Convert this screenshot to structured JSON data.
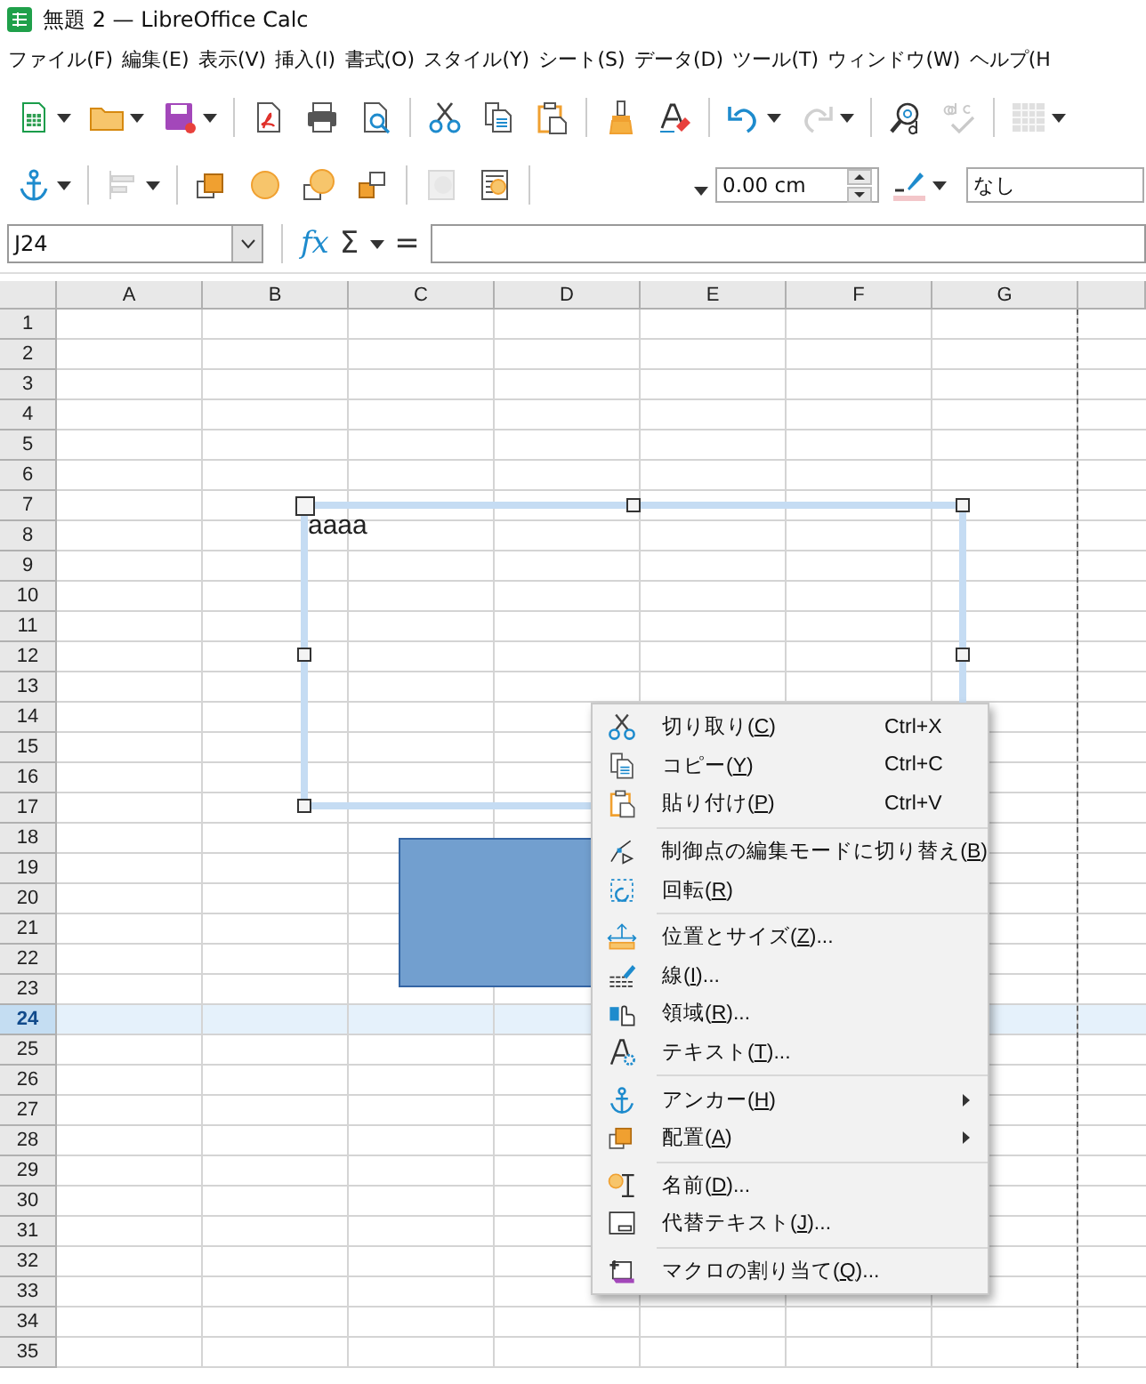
{
  "window": {
    "title": "無題 2 — LibreOffice Calc"
  },
  "menu_bar": [
    "ファイル(F)",
    "編集(E)",
    "表示(V)",
    "挿入(I)",
    "書式(O)",
    "スタイル(Y)",
    "シート(S)",
    "データ(D)",
    "ツール(T)",
    "ウィンドウ(W)",
    "ヘルプ(H"
  ],
  "toolbar_standard": [
    {
      "kind": "button",
      "dropdown": true,
      "disabled": false
    },
    {
      "kind": "button",
      "dropdown": true,
      "disabled": false
    },
    {
      "kind": "button",
      "dropdown": true,
      "disabled": false
    },
    {
      "kind": "separator"
    },
    {
      "kind": "button",
      "dropdown": false,
      "disabled": false
    },
    {
      "kind": "button",
      "dropdown": false,
      "disabled": false
    },
    {
      "kind": "button",
      "dropdown": false,
      "disabled": false
    },
    {
      "kind": "separator"
    },
    {
      "kind": "button",
      "dropdown": false,
      "disabled": false
    },
    {
      "kind": "button",
      "dropdown": false,
      "disabled": false
    },
    {
      "kind": "button",
      "dropdown": false,
      "disabled": false
    },
    {
      "kind": "separator"
    },
    {
      "kind": "button",
      "dropdown": false,
      "disabled": false
    },
    {
      "kind": "button",
      "dropdown": false,
      "disabled": false
    },
    {
      "kind": "separator"
    },
    {
      "kind": "button",
      "dropdown": true,
      "disabled": false
    },
    {
      "kind": "button",
      "dropdown": true,
      "disabled": true
    },
    {
      "kind": "separator"
    },
    {
      "kind": "button",
      "dropdown": false,
      "disabled": false
    },
    {
      "kind": "button",
      "dropdown": false,
      "disabled": true
    },
    {
      "kind": "separator"
    },
    {
      "kind": "button",
      "dropdown": true,
      "disabled": true
    }
  ],
  "toolbar_drawing": {
    "buttons": [
      {
        "kind": "button",
        "dropdown": true,
        "disabled": false
      },
      {
        "kind": "separator"
      },
      {
        "kind": "button",
        "dropdown": true,
        "disabled": true
      },
      {
        "kind": "separator"
      },
      {
        "kind": "button",
        "dropdown": false,
        "disabled": false
      },
      {
        "kind": "button",
        "dropdown": false,
        "disabled": false
      },
      {
        "kind": "button",
        "dropdown": false,
        "disabled": false
      },
      {
        "kind": "button",
        "dropdown": false,
        "disabled": false
      },
      {
        "kind": "separator"
      },
      {
        "kind": "button",
        "dropdown": false,
        "disabled": true
      },
      {
        "kind": "button",
        "dropdown": false,
        "disabled": false
      },
      {
        "kind": "separator"
      }
    ],
    "line_width": "0.00 cm",
    "area_style": "なし"
  },
  "formula_bar": {
    "name_box": "J24",
    "function_wizard": "fx",
    "sum": "Σ",
    "equals": "="
  },
  "sheet": {
    "columns": [
      "A",
      "B",
      "C",
      "D",
      "E",
      "F",
      "G"
    ],
    "rows": [
      {
        "label": "1",
        "selected": false
      },
      {
        "label": "2",
        "selected": false
      },
      {
        "label": "3",
        "selected": false
      },
      {
        "label": "4",
        "selected": false
      },
      {
        "label": "5",
        "selected": false
      },
      {
        "label": "6",
        "selected": false
      },
      {
        "label": "7",
        "selected": false
      },
      {
        "label": "8",
        "selected": false
      },
      {
        "label": "9",
        "selected": false
      },
      {
        "label": "10",
        "selected": false
      },
      {
        "label": "11",
        "selected": false
      },
      {
        "label": "12",
        "selected": false
      },
      {
        "label": "13",
        "selected": false
      },
      {
        "label": "14",
        "selected": false
      },
      {
        "label": "15",
        "selected": false
      },
      {
        "label": "16",
        "selected": false
      },
      {
        "label": "17",
        "selected": false
      },
      {
        "label": "18",
        "selected": false
      },
      {
        "label": "19",
        "selected": false
      },
      {
        "label": "20",
        "selected": false
      },
      {
        "label": "21",
        "selected": false
      },
      {
        "label": "22",
        "selected": false
      },
      {
        "label": "23",
        "selected": false
      },
      {
        "label": "24",
        "selected": true
      },
      {
        "label": "25",
        "selected": false
      },
      {
        "label": "26",
        "selected": false
      },
      {
        "label": "27",
        "selected": false
      },
      {
        "label": "28",
        "selected": false
      },
      {
        "label": "29",
        "selected": false
      },
      {
        "label": "30",
        "selected": false
      },
      {
        "label": "31",
        "selected": false
      },
      {
        "label": "32",
        "selected": false
      },
      {
        "label": "33",
        "selected": false
      },
      {
        "label": "34",
        "selected": false
      },
      {
        "label": "35",
        "selected": false
      }
    ],
    "text_box": {
      "text": "aaaa"
    }
  },
  "context_menu": [
    {
      "kind": "item",
      "label": "切り取り(C)",
      "shortcut": "Ctrl+X",
      "submenu": false
    },
    {
      "kind": "item",
      "label": "コピー(Y)",
      "shortcut": "Ctrl+C",
      "submenu": false
    },
    {
      "kind": "item",
      "label": "貼り付け(P)",
      "shortcut": "Ctrl+V",
      "submenu": false
    },
    {
      "kind": "separator"
    },
    {
      "kind": "item",
      "label": "制御点の編集モードに切り替え(B)",
      "submenu": false
    },
    {
      "kind": "item",
      "label": "回転(R)",
      "submenu": false
    },
    {
      "kind": "separator"
    },
    {
      "kind": "item",
      "label": "位置とサイズ(Z)...",
      "submenu": false
    },
    {
      "kind": "item",
      "label": "線(I)...",
      "submenu": false
    },
    {
      "kind": "item",
      "label": "領域(R)...",
      "submenu": false
    },
    {
      "kind": "item",
      "label": "テキスト(T)...",
      "submenu": false
    },
    {
      "kind": "separator"
    },
    {
      "kind": "item",
      "label": "アンカー(H)",
      "submenu": true
    },
    {
      "kind": "item",
      "label": "配置(A)",
      "submenu": true
    },
    {
      "kind": "separator"
    },
    {
      "kind": "item",
      "label": "名前(D)...",
      "submenu": false
    },
    {
      "kind": "item",
      "label": "代替テキスト(J)...",
      "submenu": false
    },
    {
      "kind": "separator"
    },
    {
      "kind": "item",
      "label": "マクロの割り当て(Q)...",
      "submenu": false
    }
  ]
}
